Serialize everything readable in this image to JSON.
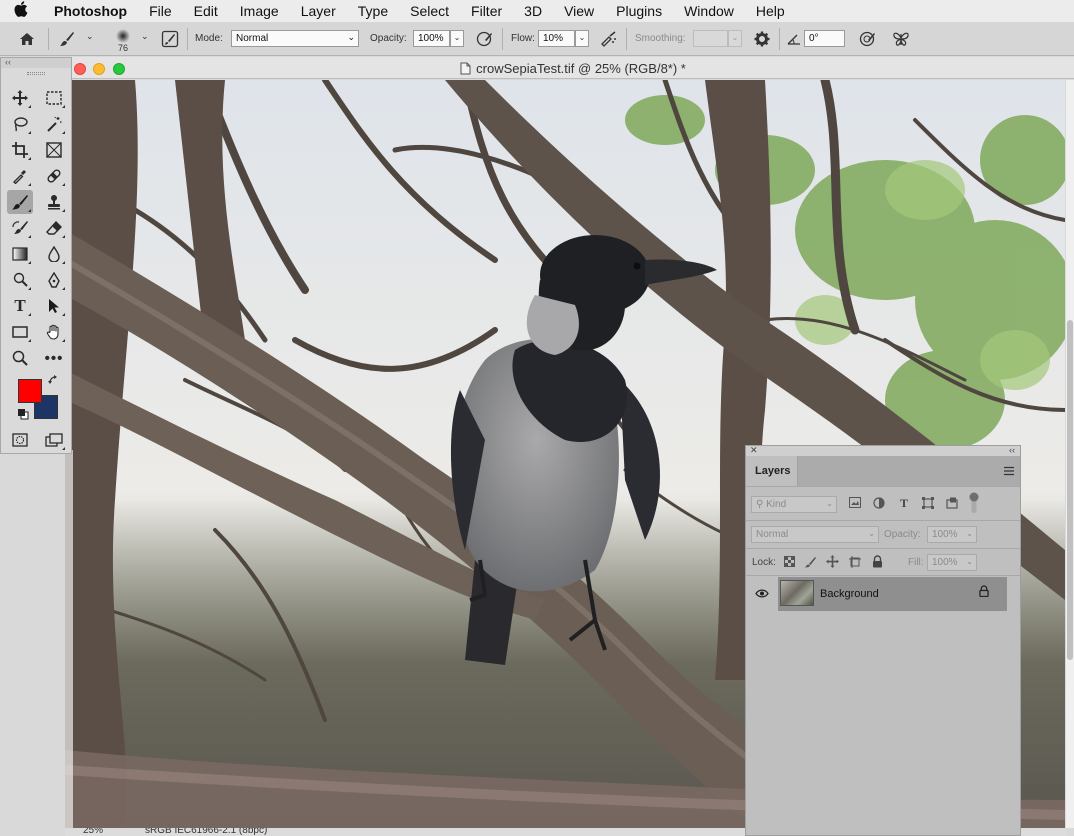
{
  "menubar": {
    "app_name": "Photoshop",
    "items": [
      "File",
      "Edit",
      "Image",
      "Layer",
      "Type",
      "Select",
      "Filter",
      "3D",
      "View",
      "Plugins",
      "Window",
      "Help"
    ]
  },
  "options": {
    "brush_size": "76",
    "mode_label": "Mode:",
    "mode_value": "Normal",
    "opacity_label": "Opacity:",
    "opacity_value": "100%",
    "flow_label": "Flow:",
    "flow_value": "10%",
    "smoothing_label": "Smoothing:",
    "smoothing_value": "",
    "angle_value": "0°"
  },
  "document": {
    "title": "crowSepiaTest.tif @ 25% (RGB/8*) *",
    "zoom": "25%",
    "color_profile": "sRGB IEC61966-2.1 (8bpc)"
  },
  "colors": {
    "foreground": "#ff0000",
    "background": "#1c3466"
  },
  "layers_panel": {
    "tab_label": "Layers",
    "filter_kind": "Kind",
    "blend_mode": "Normal",
    "opacity_label": "Opacity:",
    "opacity_value": "100%",
    "lock_label": "Lock:",
    "fill_label": "Fill:",
    "fill_value": "100%",
    "layers": [
      {
        "name": "Background",
        "visible": true,
        "locked": true
      }
    ]
  }
}
